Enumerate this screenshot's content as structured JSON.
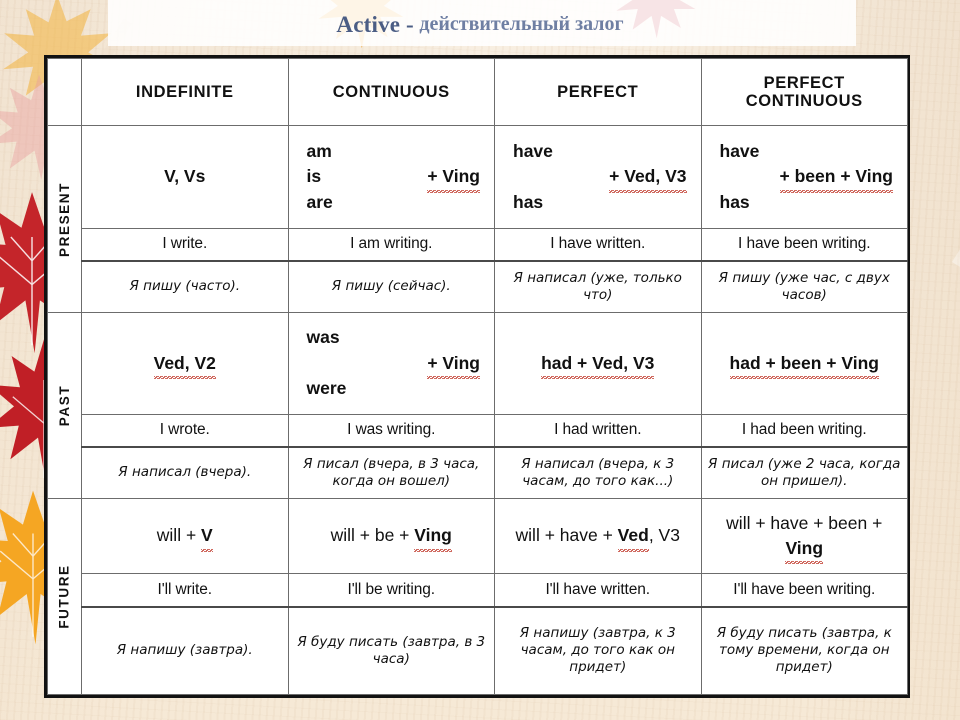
{
  "title": {
    "english": "Active",
    "separator": " - ",
    "russian": "действительный залог"
  },
  "table": {
    "corner_label": "",
    "column_headers": [
      "INDEFINITE",
      "CONTINUOUS",
      "PERFECT",
      "PERFECT CONTINUOUS"
    ],
    "row_labels": [
      "PRESENT",
      "PAST",
      "FUTURE"
    ],
    "rows": [
      {
        "label": "PRESENT",
        "formulas": [
          {
            "kind": "center",
            "text": "V, Vs"
          },
          {
            "kind": "stack",
            "line1": "am",
            "line2": "is",
            "line3": "are",
            "right": "+ Ving",
            "squiggle": "Ving"
          },
          {
            "kind": "stack",
            "line1": "have",
            "line2": "",
            "line3": "has",
            "right": "+ Ved, V3",
            "squiggle": "Ved"
          },
          {
            "kind": "stack",
            "line1": "have",
            "line2": "",
            "line3": "has",
            "right": "+ been + Ving",
            "squiggle": "Ving"
          }
        ],
        "examples": [
          "I write.",
          "I am writing.",
          "I have written.",
          "I have been writing."
        ],
        "translations": [
          "Я пишу (часто).",
          "Я пишу (сейчас).",
          "Я написал (уже, только что)",
          "Я пишу (уже час, с двух часов)"
        ]
      },
      {
        "label": "PAST",
        "formulas": [
          {
            "kind": "center",
            "text": "Ved, V2",
            "squiggle": "Ved"
          },
          {
            "kind": "stack",
            "line1": "was",
            "line2": "",
            "line3": "were",
            "right": "+ Ving",
            "squiggle": "Ving"
          },
          {
            "kind": "center",
            "text": "had  + Ved, V3",
            "squiggle": "Ved"
          },
          {
            "kind": "center",
            "text": "had + been + Ving",
            "squiggle": "Ving"
          }
        ],
        "examples": [
          "I wrote.",
          "I was writing.",
          "I had written.",
          "I had been writing."
        ],
        "translations": [
          "Я написал (вчера).",
          "Я писал (вчера, в 3 часа, когда он вошел)",
          "Я написал (вчера, к 3 часам, до того как...)",
          "Я писал (уже 2 часа, когда он пришел)."
        ]
      },
      {
        "label": "FUTURE",
        "formulas": [
          {
            "kind": "plain",
            "text": "will + V",
            "boldpart": "V"
          },
          {
            "kind": "plain",
            "text": "will + be + Ving",
            "boldpart": "Ving"
          },
          {
            "kind": "plain",
            "text": "will + have + Ved, V3",
            "boldpart": "Ved"
          },
          {
            "kind": "plain",
            "text": "will + have + been + Ving",
            "boldpart": "Ving"
          }
        ],
        "examples": [
          "I'll write.",
          "I'll be writing.",
          "I'll have written.",
          "I'll have been writing."
        ],
        "translations": [
          "Я напишу (завтра).",
          "Я буду писать (завтра, в 3 часа)",
          "Я напишу (завтра, к 3 часам, до того как он придет)",
          "Я буду писать (завтра, к тому времени, когда он придет)"
        ]
      }
    ]
  },
  "colors": {
    "title_english": "#4b5d84",
    "title_russian": "#6f7fa3",
    "border_heavy": "#121212",
    "border_light": "#6c6c6c",
    "spellcheck_underline": "#c0392b",
    "leaf_red": "#c4252a",
    "leaf_orange": "#f5a623",
    "background_paper": "#f6e9d6"
  }
}
